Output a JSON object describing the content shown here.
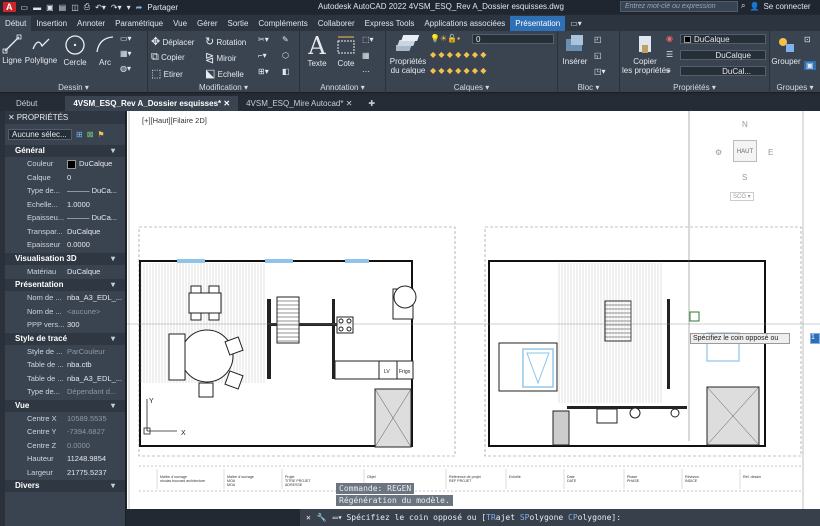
{
  "titlebar": {
    "logo": "A",
    "share_label": "Partager",
    "title": "Autodesk AutoCAD 2022    4VSM_ESQ_Rev A_Dossier esquisses.dwg",
    "search_placeholder": "Entrez mot-clé ou expression",
    "signin": "Se connecter"
  },
  "ribbon_tabs": [
    "Début",
    "Insertion",
    "Annoter",
    "Paramétrique",
    "Vue",
    "Gérer",
    "Sortie",
    "Compléments",
    "Collaborer",
    "Express Tools",
    "Applications associées",
    "Présentation"
  ],
  "ribbon": {
    "dessin": {
      "title": "Dessin",
      "ligne": "Ligne",
      "polyligne": "Polyligne",
      "cercle": "Cercle",
      "arc": "Arc"
    },
    "modification": {
      "title": "Modification",
      "deplacer": "Déplacer",
      "rotation": "Rotation",
      "copier": "Copier",
      "miroir": "Miroir",
      "etirer": "Etirer",
      "echelle": "Echelle"
    },
    "annotation": {
      "title": "Annotation",
      "texte": "Texte",
      "cote": "Cote"
    },
    "calques": {
      "title": "Calques",
      "proprietes": "Propriétés",
      "du_calque": "du calque",
      "layer_value": "0"
    },
    "bloc": {
      "title": "Bloc",
      "inserer": "Insérer"
    },
    "proprietes": {
      "title": "Propriétés",
      "copier": "Copier",
      "les_proprietes": "les propriétés",
      "color": "DuCalque",
      "linetype": "DuCalque",
      "lineweight": "DuCal..."
    },
    "groupes": {
      "title": "Groupes",
      "grouper": "Grouper"
    }
  },
  "doc_tabs": [
    "Début",
    "4VSM_ESQ_Rev A_Dossier esquisses*",
    "4VSM_ESQ_Mire Autocad*"
  ],
  "properties": {
    "title": "PROPRIÉTÉS",
    "selection": "Aucune sélec...",
    "sections": {
      "general": {
        "title": "Général",
        "rows": [
          {
            "k": "Couleur",
            "v": "DuCalque"
          },
          {
            "k": "Calque",
            "v": "0"
          },
          {
            "k": "Type de...",
            "v": "——— DuCa..."
          },
          {
            "k": "Echelle...",
            "v": "1.0000"
          },
          {
            "k": "Epaisseu...",
            "v": "——— DuCa..."
          },
          {
            "k": "Transpar...",
            "v": "DuCalque"
          },
          {
            "k": "Epaisseur",
            "v": "0.0000"
          }
        ]
      },
      "vis3d": {
        "title": "Visualisation 3D",
        "rows": [
          {
            "k": "Matériau",
            "v": "DuCalque"
          }
        ]
      },
      "presentation": {
        "title": "Présentation",
        "rows": [
          {
            "k": "Nom de ...",
            "v": "nba_A3_EDL_..."
          },
          {
            "k": "Nom de ...",
            "v": "<aucune>"
          },
          {
            "k": "PPP vers...",
            "v": "300"
          }
        ]
      },
      "style": {
        "title": "Style de tracé",
        "rows": [
          {
            "k": "Style de ...",
            "v": "ParCouleur"
          },
          {
            "k": "Table de ...",
            "v": "nba.ctb"
          },
          {
            "k": "Table de ...",
            "v": "nba_A3_EDL_..."
          },
          {
            "k": "Type de...",
            "v": "Dépendant d..."
          }
        ]
      },
      "vue": {
        "title": "Vue",
        "rows": [
          {
            "k": "Centre X",
            "v": "10589.5535"
          },
          {
            "k": "Centre Y",
            "v": "-7394.6827"
          },
          {
            "k": "Centre Z",
            "v": "0.0000"
          },
          {
            "k": "Hauteur",
            "v": "11248.9854"
          },
          {
            "k": "Largeur",
            "v": "21775.5237"
          }
        ]
      },
      "divers": {
        "title": "Divers"
      }
    }
  },
  "viewport": {
    "label": "[+][Haut][Filaire 2D]"
  },
  "viewcube": {
    "face": "HAUT",
    "n": "N",
    "s": "S",
    "e": "E",
    "w": "O",
    "wcs": "SCG"
  },
  "kitchen_labels": {
    "lv": "LV",
    "frigo": "Frigo"
  },
  "cartouche": [
    "Maître d'ouvrage",
    "Maître d'ouvrage",
    "Projet",
    "Objet",
    "Référence de projet",
    "Echelle",
    "Date",
    "Phase",
    "Révision",
    "Réf. dessin"
  ],
  "cartouche2": [
    "nicolas bouvard architecture",
    "MOA",
    "TITRE PROJET",
    "",
    "REF PROJET",
    "",
    "DATE",
    "PHASE",
    "INDICE",
    ""
  ],
  "cartouche3": [
    "",
    "MOA",
    "ADRESSE",
    "",
    "",
    "",
    "",
    "",
    "",
    ""
  ],
  "command": {
    "history1": "Commande: REGEN",
    "history2": "Régénération du modèle.",
    "prompt": "Spécifiez le coin opposé ou [",
    "opt1k": "TR",
    "opt1": "ajet ",
    "opt2k": "SP",
    "opt2": "olygone ",
    "opt3k": "CP",
    "opt3": "olygone",
    "end": "]:"
  },
  "tooltip": "Spécifiez le coin opposé ou"
}
